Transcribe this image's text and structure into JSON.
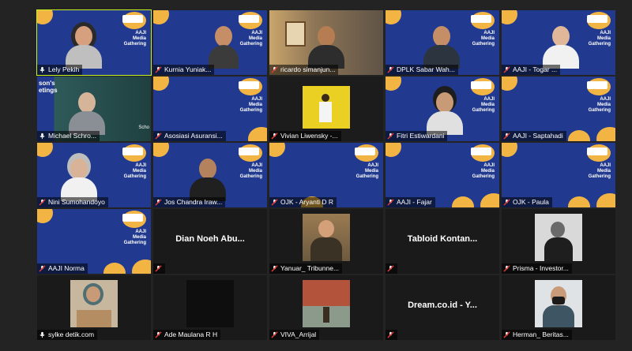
{
  "slide": {
    "line1": "AAJI",
    "line2": "Media",
    "line3": "Gathering"
  },
  "partial_slide_text": {
    "line1": "son's",
    "line2": "etings",
    "footer": "Scho"
  },
  "participants": [
    {
      "name": "Lely Pekih",
      "muted": false,
      "active": true
    },
    {
      "name": "Kurnia Yuniak...",
      "muted": true
    },
    {
      "name": "ricardo simanjun...",
      "muted": true
    },
    {
      "name": "DPLK Sabar Wah...",
      "muted": true
    },
    {
      "name": "AAJI - Togar ...",
      "muted": true
    },
    {
      "name": "Michael Schro...",
      "muted": false
    },
    {
      "name": "Asosiasi Asuransi...",
      "muted": true
    },
    {
      "name": "Vivian Liwensky -...",
      "muted": true
    },
    {
      "name": "Fitri Estiwardani",
      "muted": true
    },
    {
      "name": "AAJI - Saptahadi",
      "muted": true
    },
    {
      "name": "Nini Sumohandoyo",
      "muted": true
    },
    {
      "name": "Jos Chandra Iraw...",
      "muted": true
    },
    {
      "name": "OJK - Aryanti D R",
      "muted": true
    },
    {
      "name": "AAJI - Fajar",
      "muted": true
    },
    {
      "name": "OJK - Paula",
      "muted": true
    },
    {
      "name": "AAJI Norma",
      "muted": true
    },
    {
      "name": "",
      "big": "Dian Noeh Abu...",
      "muted": true
    },
    {
      "name": "Yanuar_ Tribunne...",
      "muted": true
    },
    {
      "name": "",
      "big": "Tabloid Kontan...",
      "muted": true
    },
    {
      "name": "Prisma - Investor...",
      "muted": true
    },
    {
      "name": "sylke detik.com",
      "muted": false
    },
    {
      "name": "Ade Maulana R H",
      "muted": true
    },
    {
      "name": "VIVA_Arrijal",
      "muted": true
    },
    {
      "name": "",
      "big": "Dream.co.id - Y...",
      "muted": true
    },
    {
      "name": "Herman_ Beritas...",
      "muted": true
    }
  ],
  "colors": {
    "slide_blue": "#213a8f",
    "slide_yellow": "#f2b544",
    "active_border": "#c9f31f",
    "mute_red": "#e53935"
  }
}
